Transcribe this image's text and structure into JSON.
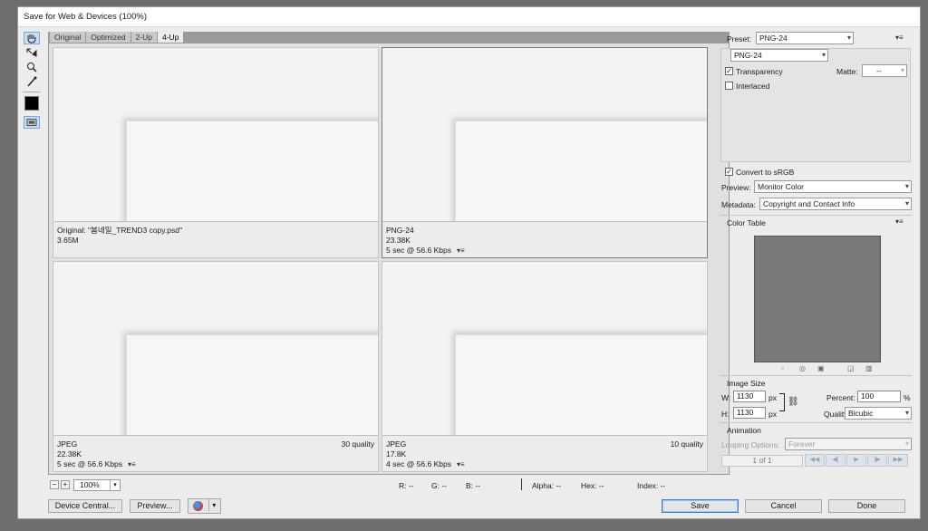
{
  "window": {
    "title": "Save for Web & Devices (100%)"
  },
  "tools": [
    {
      "name": "hand-tool-icon"
    },
    {
      "name": "slice-select-tool-icon"
    },
    {
      "name": "zoom-tool-icon"
    },
    {
      "name": "eyedropper-tool-icon"
    }
  ],
  "tabs": [
    "Original",
    "Optimized",
    "2-Up",
    "4-Up"
  ],
  "active_tab": "4-Up",
  "panes": [
    {
      "line1": "Original: \"봄네일_TREND3 copy.psd\"",
      "line2": "3.65M",
      "line3": "",
      "quality": ""
    },
    {
      "line1": "PNG-24",
      "line2": "23.38K",
      "line3": "5 sec @ 56.6 Kbps",
      "quality": ""
    },
    {
      "line1": "JPEG",
      "line2": "22.38K",
      "line3": "5 sec @ 56.6 Kbps",
      "quality": "30 quality"
    },
    {
      "line1": "JPEG",
      "line2": "17.8K",
      "line3": "4 sec @ 56.6 Kbps",
      "quality": "10 quality"
    }
  ],
  "statusbar": {
    "zoom": "100%",
    "r": "R: --",
    "g": "G: --",
    "b": "B: --",
    "alpha": "Alpha: --",
    "hex": "Hex: --",
    "index": "Index: --"
  },
  "buttons": {
    "device_central": "Device Central...",
    "preview": "Preview...",
    "save": "Save",
    "cancel": "Cancel",
    "done": "Done"
  },
  "settings": {
    "preset_label": "Preset:",
    "preset_value": "PNG-24",
    "format_value": "PNG-24",
    "transparency_label": "Transparency",
    "transparency_checked": true,
    "interlaced_label": "Interlaced",
    "interlaced_checked": false,
    "matte_label": "Matte:",
    "matte_value": "--",
    "convert_srgb_label": "Convert to sRGB",
    "convert_srgb_checked": true,
    "preview_label": "Preview:",
    "preview_value": "Monitor Color",
    "metadata_label": "Metadata:",
    "metadata_value": "Copyright and Contact Info"
  },
  "color_table": {
    "title": "Color Table"
  },
  "image_size": {
    "title": "Image Size",
    "w_label": "W:",
    "w_value": "1130",
    "h_label": "H:",
    "h_value": "1130",
    "unit": "px",
    "percent_label": "Percent:",
    "percent_value": "100",
    "percent_unit": "%",
    "quality_label": "Quality:",
    "quality_value": "Bicubic"
  },
  "animation": {
    "title": "Animation",
    "looping_label": "Looping Options:",
    "looping_value": "Forever",
    "frame_counter": "1 of 1"
  },
  "colors": {
    "accent": "#3b7ed0",
    "color_table_fill": "#7a7a7a"
  }
}
